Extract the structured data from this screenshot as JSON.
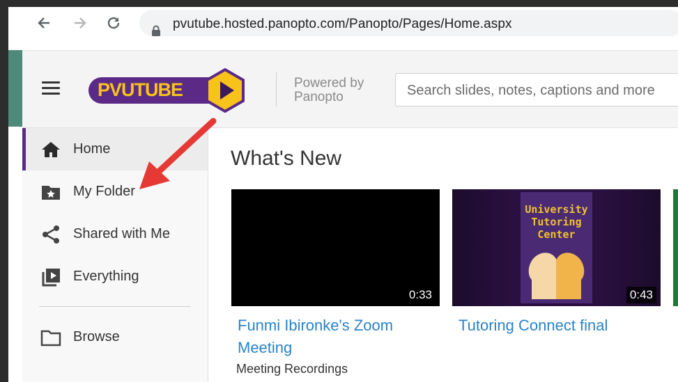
{
  "browser": {
    "url": "pvutube.hosted.panopto.com/Panopto/Pages/Home.aspx"
  },
  "header": {
    "logo_text": "PVUTUBE",
    "powered_line1": "Powered by",
    "powered_line2": "Panopto",
    "search_placeholder": "Search slides, notes, captions and more"
  },
  "sidebar": {
    "items": [
      {
        "label": "Home",
        "icon": "home-icon",
        "active": true
      },
      {
        "label": "My Folder",
        "icon": "folder-star-icon",
        "active": false
      },
      {
        "label": "Shared with Me",
        "icon": "share-icon",
        "active": false
      },
      {
        "label": "Everything",
        "icon": "play-library-icon",
        "active": false
      },
      {
        "label": "Browse",
        "icon": "folder-icon",
        "active": false
      }
    ]
  },
  "main": {
    "title": "What's New",
    "videos": [
      {
        "title_line1": "Funmi Ibironke's Zoom",
        "title_line2": "Meeting",
        "folder": "Meeting Recordings",
        "duration": "0:33"
      },
      {
        "title_line1": "Tutoring Connect final",
        "title_line2": "",
        "folder": "",
        "duration": "0:43",
        "poster_text": "University Tutoring Center"
      }
    ]
  },
  "colors": {
    "brand_purple": "#5a2a86",
    "brand_gold": "#f7c31b",
    "link_blue": "#2a83c6",
    "annotation_red": "#e53935"
  }
}
